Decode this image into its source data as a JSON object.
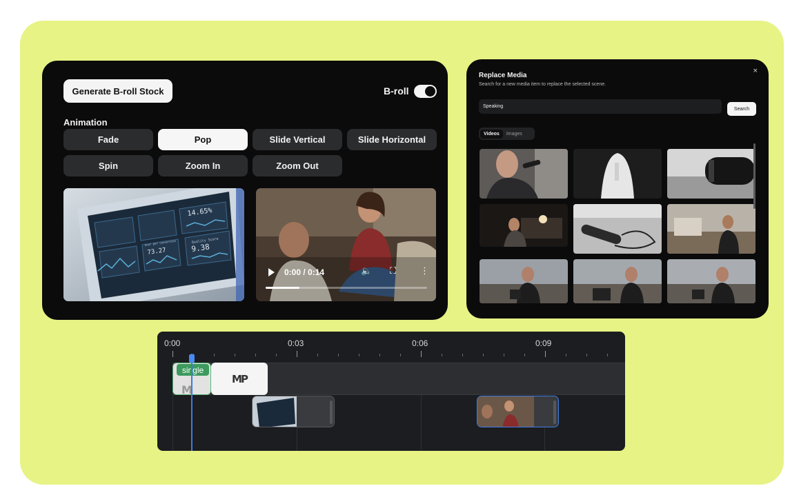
{
  "broll_panel": {
    "generate_button": "Generate B-roll Stock",
    "broll_toggle_label": "B-roll",
    "broll_enabled": true,
    "animation_heading": "Animation",
    "animations": [
      "Fade",
      "Pop",
      "Slide Vertical",
      "Slide Horizontal",
      "Spin",
      "Zoom In",
      "Zoom Out"
    ],
    "selected_animation": "Pop",
    "dashboard_stats": [
      "14.65%",
      "73.27",
      "9.38",
      "Quality Score",
      "User per conversion"
    ],
    "video": {
      "time": "0:00 / 0:14",
      "progress": 0.21
    }
  },
  "replace_media": {
    "title": "Replace Media",
    "subtitle": "Search for a new media item to replace the selected scene.",
    "close_icon": "×",
    "search_value": "Speaking",
    "search_button": "Search",
    "tabs": [
      "Videos",
      "Images"
    ],
    "active_tab": "Videos"
  },
  "timeline": {
    "time_labels": [
      "0:00",
      "0:03",
      "0:06",
      "0:09"
    ],
    "clip_badge": "single",
    "logo_text": "MP"
  },
  "colors": {
    "backdrop": "#e7f384",
    "panel": "#0b0b0c",
    "accent_blue": "#3d7be0",
    "accent_green": "#3c9a5d"
  }
}
